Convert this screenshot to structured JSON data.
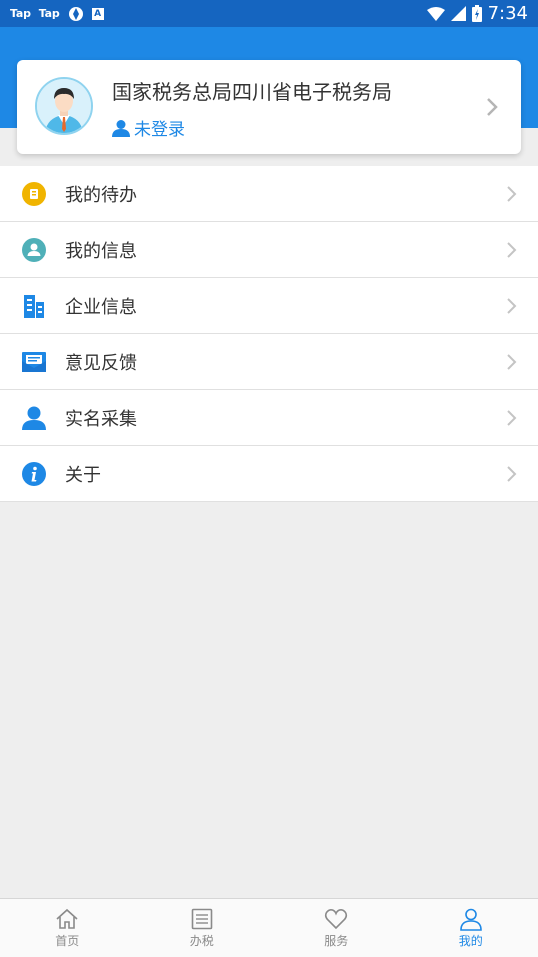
{
  "status_bar": {
    "app_icons": [
      "Tap",
      "Tap"
    ],
    "time": "7:34"
  },
  "profile": {
    "org_name": "国家税务总局四川省电子税务局",
    "login_status": "未登录"
  },
  "menu": {
    "items": [
      {
        "label": "我的待办",
        "icon": "todo-icon",
        "color": "#f0b400"
      },
      {
        "label": "我的信息",
        "icon": "user-info-icon",
        "color": "#4fb0b8"
      },
      {
        "label": "企业信息",
        "icon": "building-icon",
        "color": "#1e88e5"
      },
      {
        "label": "意见反馈",
        "icon": "feedback-mail-icon",
        "color": "#1e88e5"
      },
      {
        "label": "实名采集",
        "icon": "person-icon",
        "color": "#1e88e5"
      },
      {
        "label": "关于",
        "icon": "info-icon",
        "color": "#1e88e5"
      }
    ]
  },
  "bottom_nav": {
    "items": [
      {
        "label": "首页",
        "icon": "home-icon"
      },
      {
        "label": "办税",
        "icon": "list-icon"
      },
      {
        "label": "服务",
        "icon": "heart-icon"
      },
      {
        "label": "我的",
        "icon": "profile-icon",
        "active": true
      }
    ]
  },
  "colors": {
    "primary": "#1e88e5",
    "status_bar": "#1565c0",
    "background": "#eeeeee"
  }
}
